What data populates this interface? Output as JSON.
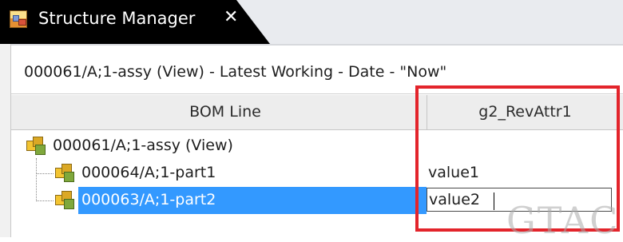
{
  "tab": {
    "title": "Structure Manager",
    "close_glyph": "✕",
    "icon": "structure-manager-icon"
  },
  "context_line": "000061/A;1-assy (View) - Latest Working - Date - \"Now\"",
  "columns": [
    {
      "label": "BOM Line"
    },
    {
      "label": "g2_RevAttr1"
    }
  ],
  "rows": [
    {
      "label": "000061/A;1-assy (View)",
      "value": "",
      "icon": "assembly-icon"
    },
    {
      "label": "000064/A;1-part1",
      "value": "value1",
      "icon": "part-icon"
    },
    {
      "label": "000063/A;1-part2",
      "value": "value2",
      "icon": "part-icon",
      "selected": true,
      "editing": true
    }
  ],
  "watermark": "GTAC",
  "colors": {
    "tab_bg": "#000000",
    "selection": "#3399ff",
    "highlight": "#e3242b",
    "header_bg": "#ededed"
  }
}
